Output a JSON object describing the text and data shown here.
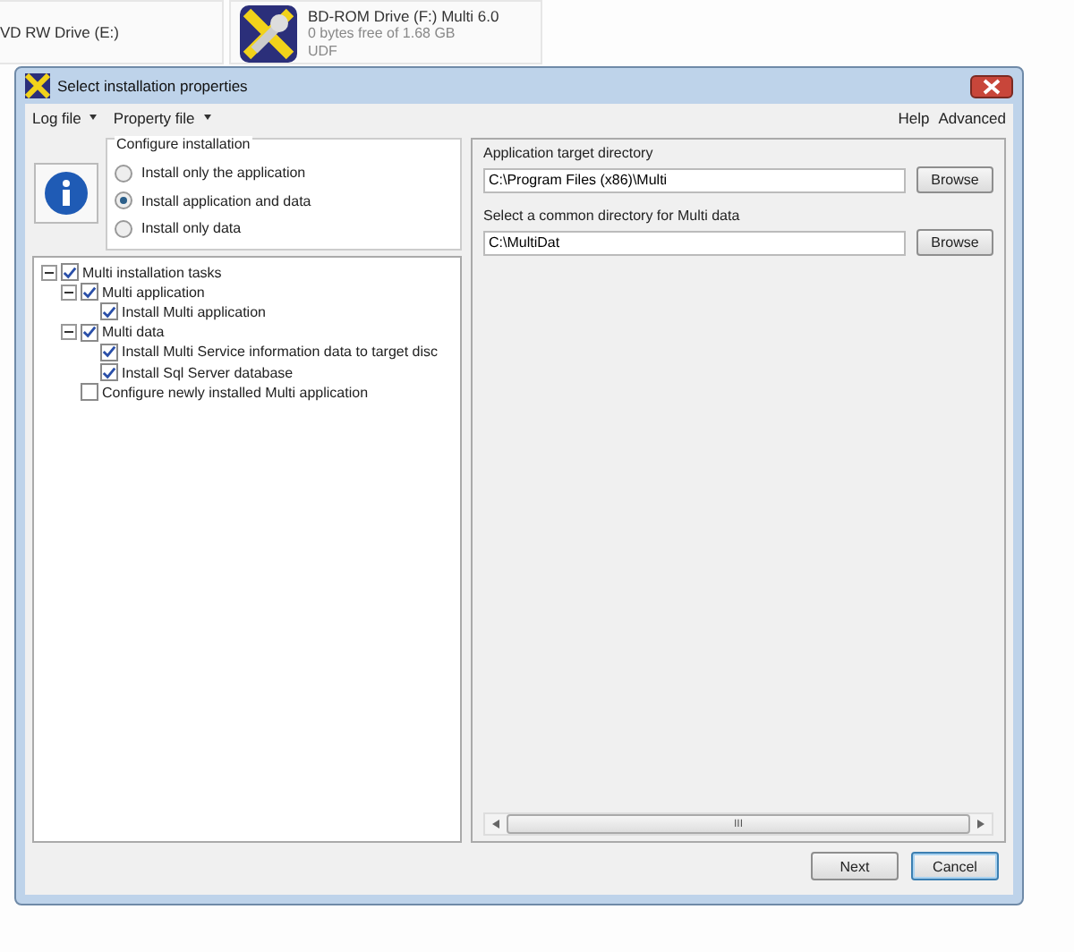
{
  "drives": [
    {
      "name": "VD RW Drive (E:)"
    },
    {
      "name": "BD-ROM Drive (F:) Multi 6.0",
      "free": "0 bytes free of 1.68 GB",
      "fs": "UDF"
    }
  ],
  "window": {
    "title": "Select installation properties"
  },
  "menu": {
    "left": [
      {
        "label": "Log file"
      },
      {
        "label": "Property file"
      }
    ],
    "right": [
      {
        "label": "Help"
      },
      {
        "label": "Advanced"
      }
    ]
  },
  "configure": {
    "title": "Configure installation",
    "options": [
      {
        "label": "Install only the application",
        "selected": false
      },
      {
        "label": "Install application and data",
        "selected": true
      },
      {
        "label": "Install only data",
        "selected": false
      }
    ]
  },
  "tasks": [
    {
      "label": "Multi installation tasks",
      "checked": true,
      "expanded": true,
      "children": [
        {
          "label": "Multi application",
          "checked": true,
          "expanded": true,
          "children": [
            {
              "label": "Install Multi application",
              "checked": true
            }
          ]
        },
        {
          "label": "Multi data",
          "checked": true,
          "expanded": true,
          "children": [
            {
              "label": "Install Multi Service information data to target disc",
              "checked": true
            },
            {
              "label": "Install Sql Server database",
              "checked": true
            }
          ]
        },
        {
          "label": "Configure newly installed Multi application",
          "checked": false
        }
      ]
    }
  ],
  "directories": [
    {
      "label": "Application target directory",
      "value": "C:\\Program Files (x86)\\Multi",
      "button": "Browse"
    },
    {
      "label": "Select a common directory for Multi data",
      "value": "C:\\MultiDat",
      "button": "Browse"
    }
  ],
  "scrollbar_grip": "III",
  "buttons": [
    {
      "label": "Next",
      "kind": "normal"
    },
    {
      "label": "Cancel",
      "kind": "default"
    }
  ]
}
